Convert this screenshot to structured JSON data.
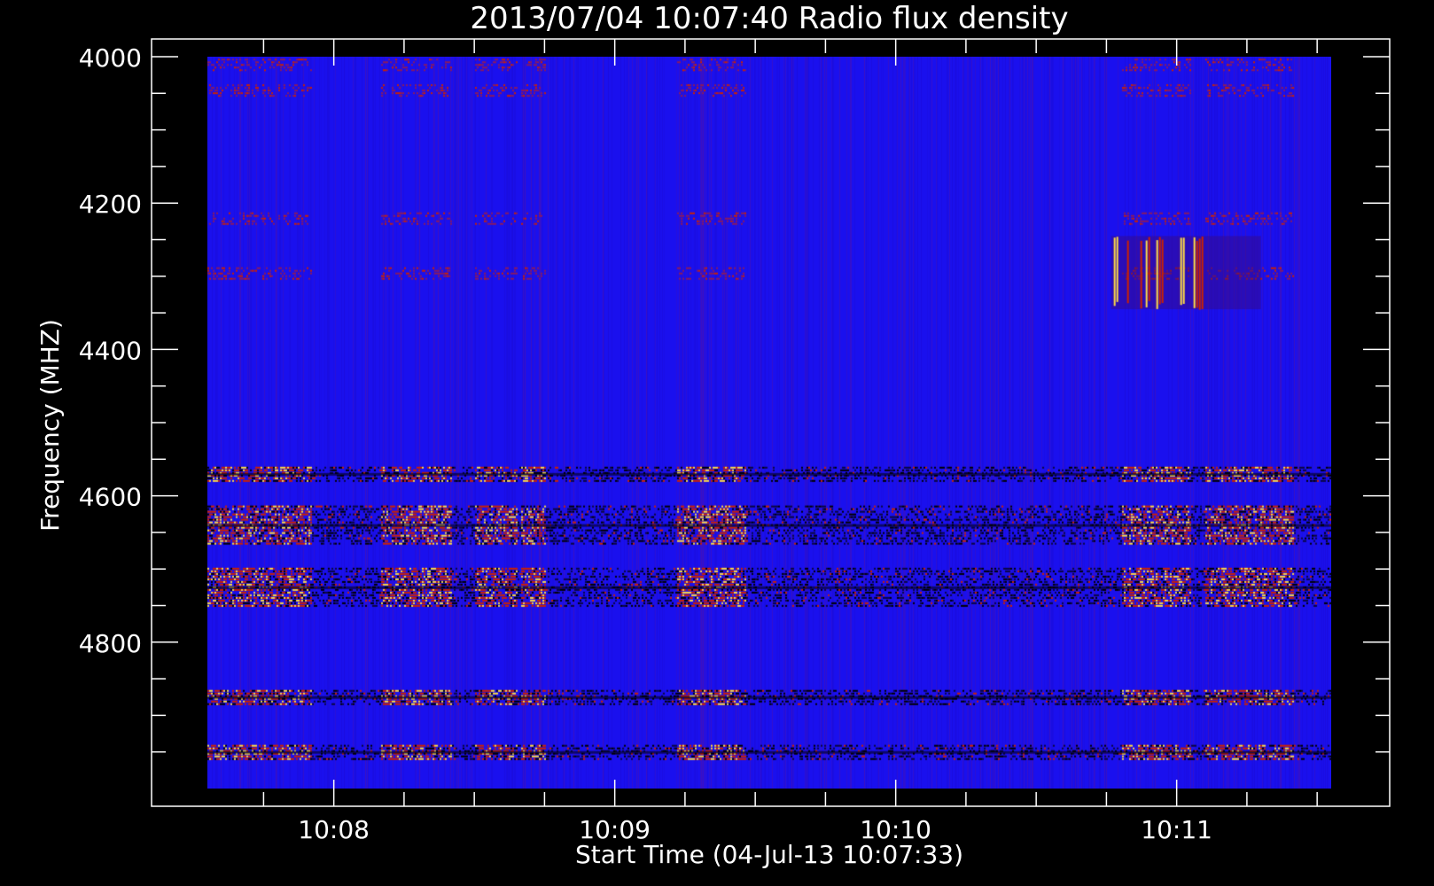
{
  "title": "2013/07/04 10:07:40 Radio flux density",
  "chart_data": {
    "type": "heatmap",
    "title": "2013/07/04 10:07:40 Radio flux density",
    "xlabel": "Start Time (04-Jul-13 10:07:33)",
    "ylabel": "Frequency (MHZ)",
    "x_tick_labels": [
      "10:08",
      "10:09",
      "10:10",
      "10:11"
    ],
    "x_ticks_seconds_since_start": [
      27,
      87,
      147,
      207
    ],
    "x_range_seconds_since_start": [
      0,
      240
    ],
    "y_tick_labels": [
      "4000",
      "4200",
      "4400",
      "4600",
      "4800"
    ],
    "y_ticks_mhz": [
      4000,
      4200,
      4400,
      4600,
      4800
    ],
    "y_range_mhz": [
      4000,
      5000
    ],
    "y_axis_inverted": true,
    "colormap": {
      "background": "#1a10ee",
      "low": "#000000",
      "mid": "#cc2200",
      "high": "#ffdd44"
    },
    "features": [
      {
        "name": "burst",
        "t_start_s": 193,
        "t_end_s": 225,
        "f_low_mhz": 4245,
        "f_high_mhz": 4345
      },
      {
        "name": "interference",
        "f_center_mhz": 4570
      },
      {
        "name": "interference",
        "f_center_mhz": 4640
      },
      {
        "name": "interference",
        "f_center_mhz": 4725
      },
      {
        "name": "interference",
        "f_center_mhz": 4875
      },
      {
        "name": "interference",
        "f_center_mhz": 4950
      }
    ]
  }
}
